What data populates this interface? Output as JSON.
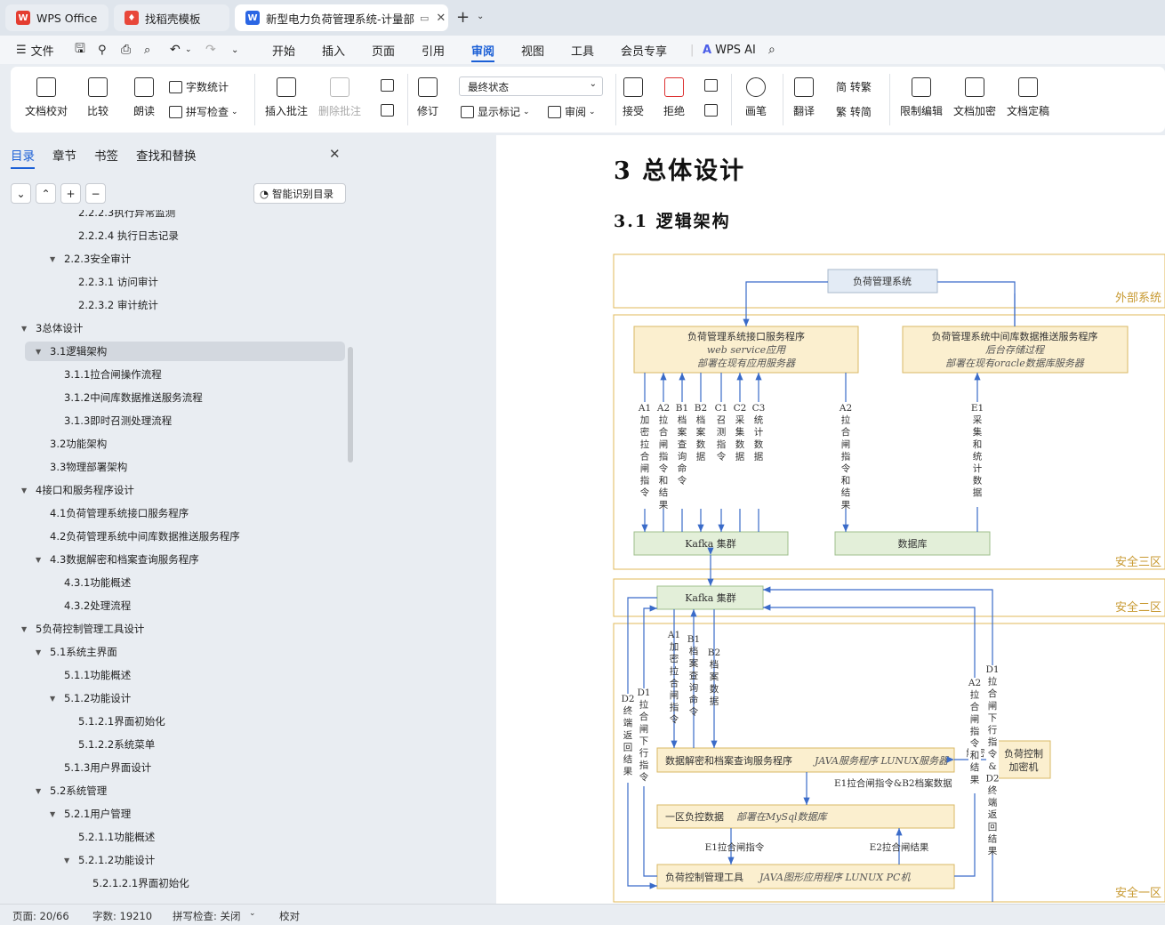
{
  "tabs": [
    {
      "label": "WPS Office"
    },
    {
      "label": "找稻壳模板"
    },
    {
      "label": "新型电力负荷管理系统-计量部"
    }
  ],
  "menu": {
    "file": "文件",
    "items": [
      "开始",
      "插入",
      "页面",
      "引用",
      "审阅",
      "视图",
      "工具",
      "会员专享"
    ],
    "active": "审阅",
    "wps_ai": "WPS AI"
  },
  "ribbon": {
    "doc_check": "文档校对",
    "compare": "比较",
    "read_aloud": "朗读",
    "word_count": "字数统计",
    "spell_check": "拼写检查",
    "insert_comment": "插入批注",
    "delete_comment": "删除批注",
    "revise": "修订",
    "final_state": "最终状态",
    "show_marks": "显示标记",
    "review": "审阅",
    "accept": "接受",
    "reject": "拒绝",
    "pen": "画笔",
    "translate": "翻译",
    "to_traditional": "简 转繁",
    "to_simplified": "繁 转简",
    "restrict_edit": "限制编辑",
    "encrypt": "文档加密",
    "finalize": "文档定稿"
  },
  "sidebar": {
    "tabs": [
      "目录",
      "章节",
      "书签",
      "查找和替换"
    ],
    "smart_toc": "智能识别目录",
    "toc": [
      {
        "text": "2.2.2.3执行异常监测",
        "level": 3,
        "arrow": false
      },
      {
        "text": "2.2.2.4  执行日志记录",
        "level": 3,
        "arrow": false
      },
      {
        "text": "2.2.3安全审计",
        "level": 2,
        "arrow": true
      },
      {
        "text": "2.2.3.1  访问审计",
        "level": 3,
        "arrow": false
      },
      {
        "text": "2.2.3.2  审计统计",
        "level": 3,
        "arrow": false
      },
      {
        "text": "3总体设计",
        "level": 0,
        "arrow": true
      },
      {
        "text": "3.1逻辑架构",
        "level": 1,
        "arrow": true,
        "selected": true
      },
      {
        "text": "3.1.1拉合闸操作流程",
        "level": 2,
        "arrow": false
      },
      {
        "text": "3.1.2中间库数据推送服务流程",
        "level": 2,
        "arrow": false
      },
      {
        "text": "3.1.3即时召测处理流程",
        "level": 2,
        "arrow": false
      },
      {
        "text": "3.2功能架构",
        "level": 1,
        "arrow": false
      },
      {
        "text": "3.3物理部署架构",
        "level": 1,
        "arrow": false
      },
      {
        "text": "4接口和服务程序设计",
        "level": 0,
        "arrow": true
      },
      {
        "text": "4.1负荷管理系统接口服务程序",
        "level": 1,
        "arrow": false
      },
      {
        "text": "4.2负荷管理系统中间库数据推送服务程序",
        "level": 1,
        "arrow": false
      },
      {
        "text": "4.3数据解密和档案查询服务程序",
        "level": 1,
        "arrow": true
      },
      {
        "text": "4.3.1功能概述",
        "level": 2,
        "arrow": false
      },
      {
        "text": "4.3.2处理流程",
        "level": 2,
        "arrow": false
      },
      {
        "text": "5负荷控制管理工具设计",
        "level": 0,
        "arrow": true
      },
      {
        "text": "5.1系统主界面",
        "level": 1,
        "arrow": true
      },
      {
        "text": "5.1.1功能概述",
        "level": 2,
        "arrow": false
      },
      {
        "text": "5.1.2功能设计",
        "level": 2,
        "arrow": true
      },
      {
        "text": "5.1.2.1界面初始化",
        "level": 3,
        "arrow": false
      },
      {
        "text": "5.1.2.2系统菜单",
        "level": 3,
        "arrow": false
      },
      {
        "text": "5.1.3用户界面设计",
        "level": 2,
        "arrow": false
      },
      {
        "text": "5.2系统管理",
        "level": 1,
        "arrow": true
      },
      {
        "text": "5.2.1用户管理",
        "level": 2,
        "arrow": true
      },
      {
        "text": "5.2.1.1功能概述",
        "level": 3,
        "arrow": false
      },
      {
        "text": "5.2.1.2功能设计",
        "level": 3,
        "arrow": true
      },
      {
        "text": "5.2.1.2.1界面初始化",
        "level": 4,
        "arrow": false
      }
    ]
  },
  "doc": {
    "h1": "3  总体设计",
    "h2": "3.1   逻辑架构",
    "diagram": {
      "zone_ext": "外部系统",
      "zone3": "安全三区",
      "zone2": "安全二区",
      "zone1": "安全一区",
      "load_sys": "负荷管理系统",
      "iface_title": "负荷管理系统接口服务程序",
      "iface_l2": "web service应用",
      "iface_l3": "部署在现有应用服务器",
      "push_title": "负荷管理系统中间库数据推送服务程序",
      "push_l2": "后台存储过程",
      "push_l3": "部署在现有oracle数据库服务器",
      "kafka3": "Kafka 集群",
      "db3": "数据库",
      "kafka2": "Kafka 集群",
      "decrypt_svc": "数据解密和档案查询服务程序",
      "decrypt_svc_it": "JAVA服务程序 LUNUX服务器",
      "decrypt_label": "解密",
      "lc_machine_1": "负荷控制",
      "lc_machine_2": "加密机",
      "e1b2": "E1拉合闸指令&B2档案数据",
      "zone1_db": "一区负控数据",
      "zone1_db_it": "部署在MySql数据库",
      "e1_cmd": "E1拉合闸指令",
      "e2_result": "E2拉合闸结果",
      "tool": "负荷控制管理工具",
      "tool_it": "JAVA图形应用程序 LUNUX PC机",
      "v_a1": "A1加密拉合闸指令",
      "v_a2": "A2拉合闸指令和结果",
      "v_b1": "B1档案查询命令",
      "v_b2": "B2档案数据",
      "v_c1": "C1召测指令",
      "v_c2": "C2采集数据",
      "v_c3": "C3统计数据",
      "v_a2b": "A2拉合闸指令和结果",
      "v_e1": "E1采集和统计数据",
      "v_a1b": "A1加密拉合闸指令",
      "v_b1b": "B1档案查询命令",
      "v_b2b": "B2档案数据",
      "v_d2": "D2终端返回结果",
      "v_d1": "D1拉合闸下行指令",
      "v_a2c": "A2拉合闸指令和结果",
      "v_d1d2": "D1拉合闸下行指令&D2终端返回结果"
    }
  },
  "status": {
    "page": "页面: 20/66",
    "words": "字数: 19210",
    "spell": "拼写检查: 关闭",
    "proof": "校对"
  },
  "colors": {
    "accent": "#1a5fd6",
    "zone_border": "#e0b85a",
    "zone_text": "#c89a32",
    "box_yellow": "#fbefcf",
    "box_green": "#e3efd9",
    "box_blue": "#e3ebf5",
    "arrow": "#3a6bc9"
  }
}
